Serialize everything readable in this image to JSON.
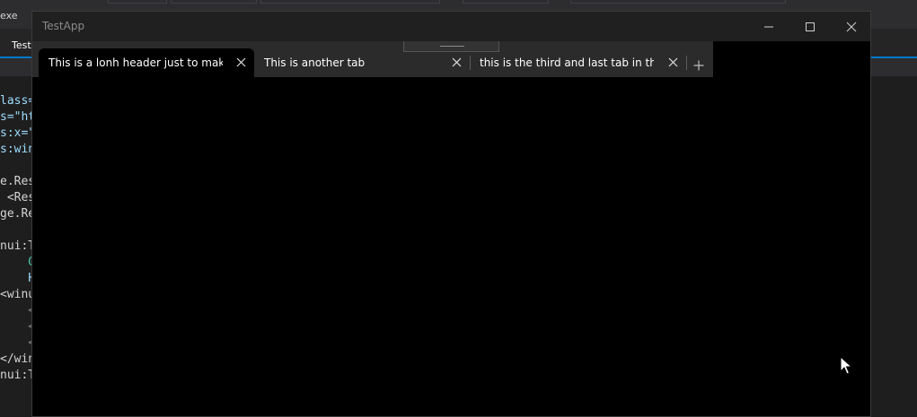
{
  "ide": {
    "run_target": "exe",
    "doc_tab": "TestA",
    "code_lines": [
      {
        "text": "lass=\"",
        "cls": "attr"
      },
      {
        "text": "s=\"ht",
        "cls": "attr"
      },
      {
        "text": "s:x=\"",
        "cls": "attr"
      },
      {
        "text": "s:win",
        "cls": "attr"
      },
      {
        "text": "",
        "cls": ""
      },
      {
        "text": "e.Res",
        "cls": "plain"
      },
      {
        "text": " <Reso",
        "cls": "plain"
      },
      {
        "text": "ge.Re",
        "cls": "plain"
      },
      {
        "text": "",
        "cls": ""
      },
      {
        "text": "nui:Ta",
        "cls": "plain"
      },
      {
        "text": "    G",
        "cls": "teal"
      },
      {
        "text": "    H",
        "cls": "attr"
      },
      {
        "text": "<winu",
        "cls": "plain"
      },
      {
        "text": "    <",
        "cls": "gray"
      },
      {
        "text": "    <",
        "cls": "gray"
      },
      {
        "text": "    <",
        "cls": "gray"
      },
      {
        "text": "</win",
        "cls": "plain"
      },
      {
        "text": "nui:T",
        "cls": "plain"
      }
    ]
  },
  "window": {
    "title": "TestApp"
  },
  "tabs": [
    {
      "label": "This is a lonh header just to make mo",
      "active": true
    },
    {
      "label": "This is another tab",
      "active": false
    },
    {
      "label": "this is the third and last tab in the ro",
      "active": false
    }
  ],
  "colors": {
    "ide_accent": "#007acc",
    "window_bg": "#000000",
    "tabstrip_bg": "#2b2b2b",
    "titlebar_bg": "#202020"
  },
  "icons": {
    "minimize": "minimize-icon",
    "maximize": "maximize-icon",
    "close": "close-icon",
    "tab_close": "close-icon",
    "add_tab": "plus-icon",
    "cursor": "mouse-pointer-icon"
  }
}
